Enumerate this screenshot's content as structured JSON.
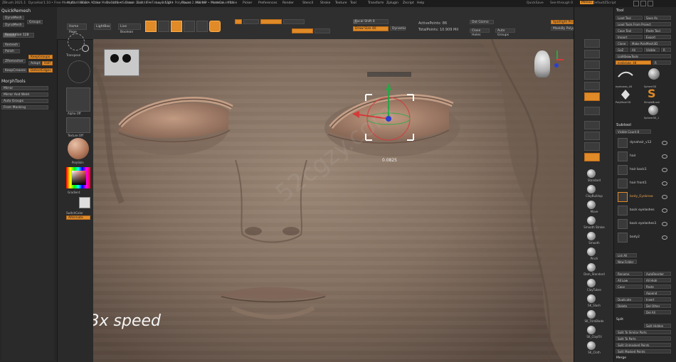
{
  "titlebar": {
    "app": "ZBrush 2021.1",
    "document": "DynaHair1.10",
    "stats": "• Free Mem 42.466GB • Active Mem 7435 • Scratch Disk 48 • Timer 2.556 • PolyCount 2.066 MP • MeshCount 10",
    "quicksave": "QuickSave",
    "see_through": "See-through 0",
    "menus_label": "Menus",
    "default_script": "DefaultZScript"
  },
  "menubar": [
    "Alpha",
    "Brush",
    "Color",
    "Document",
    "Draw",
    "Edit",
    "File",
    "Layer",
    "Light",
    "Macro",
    "Marker",
    "Material",
    "Movie",
    "Picker",
    "Preferences",
    "Render",
    "Stencil",
    "Stroke",
    "Texture",
    "Tool",
    "Transform",
    "Zplugin",
    "Zscript",
    "Help"
  ],
  "left_palette": {
    "quickremesh": "QuickRemesh",
    "dynamesh": "DynaMesh",
    "groups": "Groups",
    "dynamesh_btn": "DynaMesh",
    "resolution": "Resolution 128",
    "remesh": "Remesh",
    "polish": "Polish",
    "zremesher": "ZRemesher",
    "keepgroups": "KeepGroups",
    "adapt": "Adapt",
    "half": "Half",
    "keep_creases": "KeepCreases",
    "detect_edges": "DetectEdges",
    "morphtools": "MorphTools",
    "mirror": "Mirror",
    "mirror_weld": "Mirror And Weld",
    "auto_groups": "Auto Groups",
    "from_masking": "From Masking"
  },
  "top_shelf": {
    "home_page": "Home Page",
    "lightbox": "LightBox",
    "live_boolean": "Live Boolean",
    "edit": "Edit",
    "draw": "Draw",
    "move": "Move",
    "scale": "Scale",
    "rotate": "Rotate",
    "focal_shift": "Focal Shift 0",
    "draw_size": "Draw Size 46",
    "dynamic": "Dynamic",
    "active_points": "ActivePoints: 86",
    "total_points": "TotalPoints: 10.909 Mil",
    "gizmo_label": "Gizmo",
    "dot_gizmo": "Dot Gizmo",
    "close_holes": "Close Holes",
    "auto_groups": "Auto Groups",
    "spotlight": "Spotlight Projection",
    "mask_polygroups": "MaskBy Polygroups 0"
  },
  "left_strip": {
    "transpose": "Transpose",
    "alpha_off": "Alpha Off",
    "texture_off": "Texture Off",
    "material": "PolySkin",
    "gradient": "Gradient",
    "switch_color": "SwitchColor",
    "alternate": "Alternate",
    "primary_color": "#ffffff",
    "secondary_color": "#000000"
  },
  "viewport": {
    "scale_readout": "0.0825",
    "caption": "3x speed",
    "watermark": "52cgzy.com"
  },
  "right_strip": {
    "brushes": [
      "Standard",
      "ClayBuildup",
      "Move",
      "Smooth Stroke",
      "Smooth",
      "Pinch",
      "Dam_Standard",
      "ClayTubes",
      "SK_Slash",
      "SK_TrimBlade",
      "SK_ClayFill",
      "SK_Cloth"
    ]
  },
  "right_palette": {
    "tool": "Tool",
    "load_tool": "Load Tool",
    "save_as": "Save As",
    "load_tools_project": "Load Tools From Project",
    "copy_tool": "Copy Tool",
    "paste_tool": "Paste Tool",
    "import": "Import",
    "export": "Export",
    "clone": "Clone",
    "make_polymesh": "Make PolyMesh3D",
    "goz": "GoZ",
    "all": "All",
    "visible": "Visible",
    "r": "R",
    "lightbox_tools": "Lightbox▸Tools",
    "eyebrows": "eyebrows_48",
    "thumbs": [
      "eyebrows_48",
      "Sphere3D",
      "Cylinder3D",
      "SimpleBrush",
      "PolyMesh3D",
      "Sphere3D_1"
    ],
    "subtool": "Subtool",
    "visible_count": "Visible Count 8",
    "subtools": [
      {
        "name": "dynahair_v12",
        "active": false
      },
      {
        "name": "hair",
        "active": false
      },
      {
        "name": "hair back1",
        "active": false
      },
      {
        "name": "hair front1",
        "active": false
      },
      {
        "name": "body_Eyebrow",
        "active": true
      },
      {
        "name": "back eyelashes",
        "active": false
      },
      {
        "name": "back eyelashes1",
        "active": false
      },
      {
        "name": "body2",
        "active": false
      }
    ],
    "list_all": "List All",
    "new_folder": "New Folder",
    "rename": "Rename",
    "autoreorder": "AutoReorder",
    "all_low": "All Low",
    "all_high": "All High",
    "copy": "Copy",
    "paste": "Paste",
    "duplicate": "Duplicate",
    "append": "Append",
    "insert": "Insert",
    "delete": "Delete",
    "del_other": "Del Other",
    "del_all": "Del All",
    "split": "Split",
    "split_hidden": "Split Hidden",
    "split_polygroups": "Split To Similar Parts",
    "split_parts": "Split To Parts",
    "split_unmasked": "Split Unmasked Points",
    "split_masked": "Split Masked Points",
    "merge": "Merge"
  }
}
